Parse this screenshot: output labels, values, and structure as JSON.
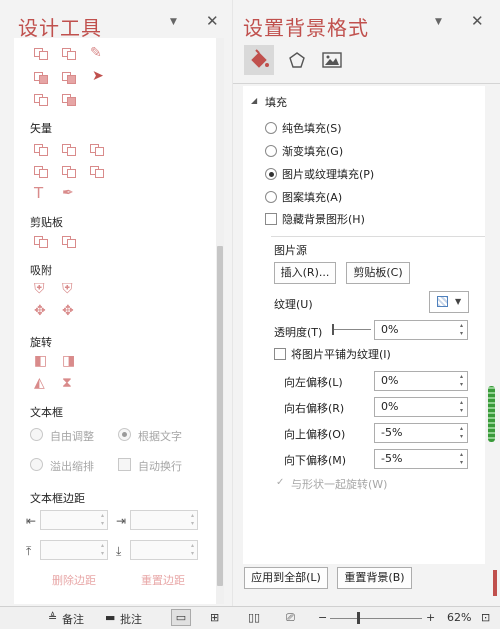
{
  "left_pane": {
    "title": "设计工具",
    "sections": {
      "vector": "矢量",
      "clipboard": "剪贴板",
      "snap": "吸附",
      "rotate": "旋转",
      "textbox": "文本框",
      "textbox_margin": "文本框边距"
    },
    "textbox": {
      "auto_adjust": "自由调整",
      "fit_text": "根据文字",
      "overflow_shrink": "溢出缩排",
      "auto_wrap": "自动换行"
    },
    "margin_labels": {
      "left": "⇤",
      "right": "⇥",
      "top": "⤒",
      "bottom": "⤓"
    },
    "delete_margin": "删除边距",
    "reset_margin": "重置边距"
  },
  "right_pane": {
    "title": "设置背景格式",
    "section": "填充",
    "options": [
      {
        "label": "纯色填充(S)",
        "checked": false
      },
      {
        "label": "渐变填充(G)",
        "checked": false
      },
      {
        "label": "图片或纹理填充(P)",
        "checked": true
      },
      {
        "label": "图案填充(A)",
        "checked": false
      }
    ],
    "hide_bg_graphics": "隐藏背景图形(H)",
    "picture_source": "图片源",
    "insert_btn": "插入(R)...",
    "clipboard_btn": "剪贴板(C)",
    "texture_label": "纹理(U)",
    "transparency_label": "透明度(T)",
    "transparency_value": "0%",
    "tile_label": "将图片平铺为纹理(I)",
    "offsets": [
      {
        "label": "向左偏移(L)",
        "value": "0%"
      },
      {
        "label": "向右偏移(R)",
        "value": "0%"
      },
      {
        "label": "向上偏移(O)",
        "value": "-5%"
      },
      {
        "label": "向下偏移(M)",
        "value": "-5%"
      }
    ],
    "rotate_with_shape": "与形状一起旋转(W)",
    "apply_all_btn": "应用到全部(L)",
    "reset_bg_btn": "重置背景(B)"
  },
  "status_bar": {
    "notes": "备注",
    "comments": "批注",
    "zoom_minus": "−",
    "zoom_plus": "+",
    "zoom": "62%"
  },
  "colors": {
    "accent": "#c0504d",
    "icon_pink": "#d98b8b",
    "panel_bg": "#f3f3f3"
  }
}
